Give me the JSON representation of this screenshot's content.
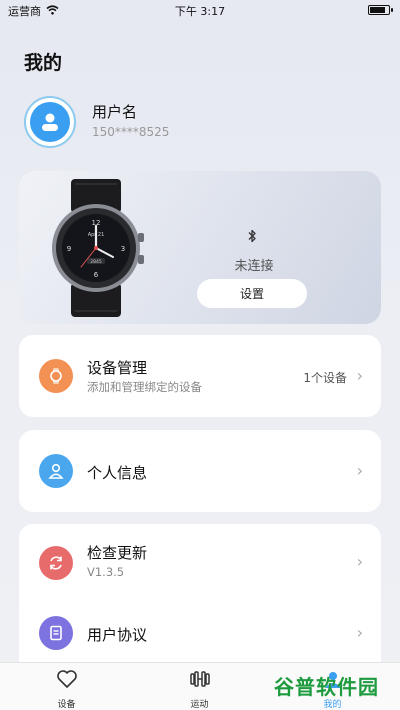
{
  "status_bar": {
    "carrier": "运营商",
    "time": "下午 3:17"
  },
  "page": {
    "title": "我的"
  },
  "user": {
    "name": "用户名",
    "phone": "150****8525",
    "avatar_icon": "user-icon"
  },
  "device": {
    "watch_face_text": "Apr 21",
    "watch_small_text": "2845",
    "bluetooth_icon": "bluetooth-icon",
    "status": "未连接",
    "settings_label": "设置"
  },
  "menu": {
    "device_management": {
      "title": "设备管理",
      "subtitle": "添加和管理绑定的设备",
      "count": "1个设备",
      "icon": "watch-icon",
      "color": "#f39155"
    },
    "personal_info": {
      "title": "个人信息",
      "icon": "person-icon",
      "color": "#4aa7ee"
    },
    "check_update": {
      "title": "检查更新",
      "subtitle": "V1.3.5",
      "icon": "refresh-icon",
      "color": "#e86b6b"
    },
    "user_agreement": {
      "title": "用户协议",
      "icon": "document-icon",
      "color": "#7c73e0"
    }
  },
  "tabs": [
    {
      "label": "设备",
      "icon": "heart-icon"
    },
    {
      "label": "运动",
      "icon": "dumbbell-icon"
    },
    {
      "label": "我的",
      "icon": "person-icon"
    }
  ],
  "watermark": "谷普软件园"
}
